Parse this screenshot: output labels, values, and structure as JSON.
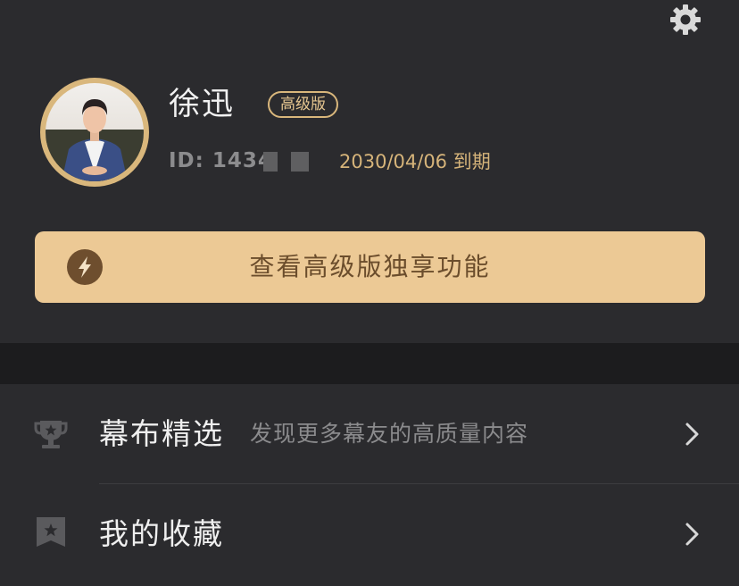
{
  "profile": {
    "name": "徐迅",
    "badge": "高级版",
    "id_text": "ID: 1434",
    "expire": "2030/04/06 到期"
  },
  "premium_button": {
    "label": "查看高级版独享功能"
  },
  "menu": {
    "items": [
      {
        "label": "幕布精选",
        "subtitle": "发现更多幕友的高质量内容",
        "icon": "trophy-icon"
      },
      {
        "label": "我的收藏",
        "subtitle": "",
        "icon": "bookmark-star-icon"
      }
    ]
  },
  "colors": {
    "background": "#2b2b2e",
    "gold_accent": "#d9b77c",
    "premium_button_bg": "#ecc995",
    "premium_text": "#6b4d2c",
    "separator_band": "#1c1c1e"
  }
}
